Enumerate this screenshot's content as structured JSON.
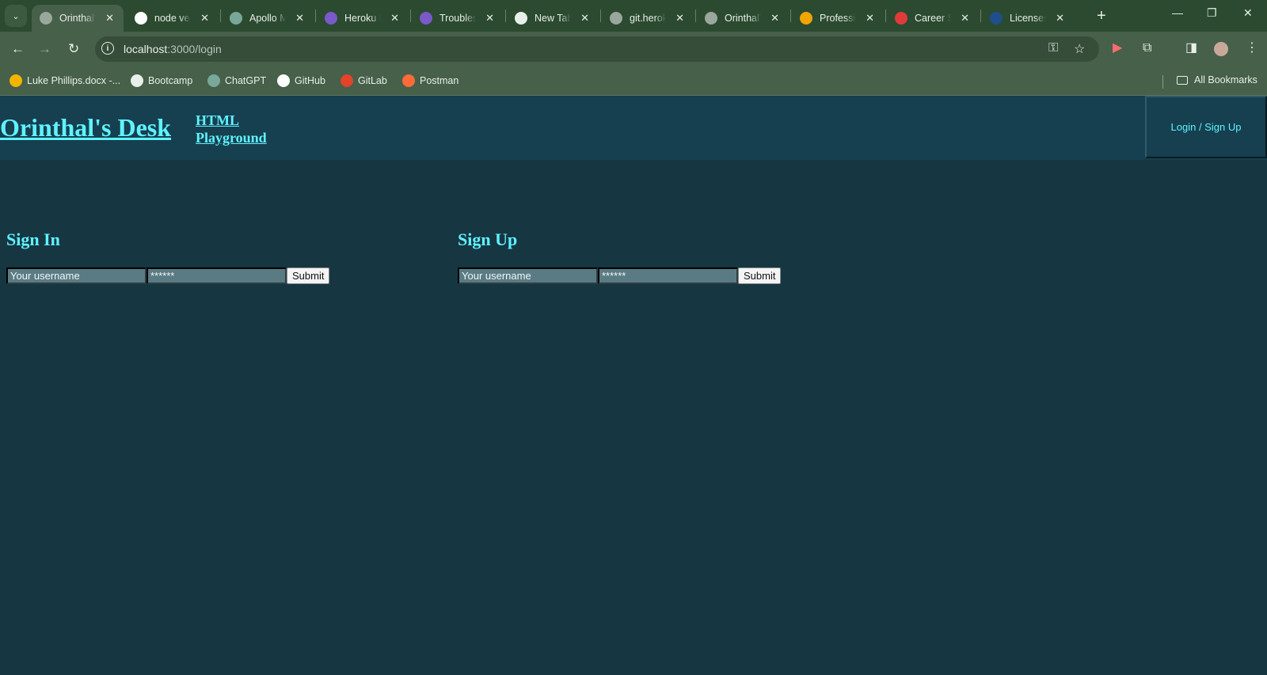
{
  "browser": {
    "tabs": [
      {
        "title": "Orinthal's Desk",
        "active": true,
        "favicon": "globe-icon",
        "color": "#9aa79c"
      },
      {
        "title": "node version",
        "active": false,
        "favicon": "google-icon",
        "color": "#ffffff"
      },
      {
        "title": "Apollo Mongo",
        "active": false,
        "favicon": "chatgpt-icon",
        "color": "#79a89a"
      },
      {
        "title": "Heroku Node",
        "active": false,
        "favicon": "heroku-icon",
        "color": "#7a59c9"
      },
      {
        "title": "Troubleshooting",
        "active": false,
        "favicon": "heroku-icon",
        "color": "#7a59c9"
      },
      {
        "title": "New Tab",
        "active": false,
        "favicon": "chrome-icon",
        "color": "#e8efe8"
      },
      {
        "title": "git.heroku",
        "active": false,
        "favicon": "globe-icon",
        "color": "#9aa79c"
      },
      {
        "title": "Orinthal's Desk",
        "active": false,
        "favicon": "globe-icon",
        "color": "#9aa79c"
      },
      {
        "title": "Professional",
        "active": false,
        "favicon": "fs-icon",
        "color": "#f0a500"
      },
      {
        "title": "Career Services",
        "active": false,
        "favicon": "career-icon",
        "color": "#e03b3b"
      },
      {
        "title": "Licenses",
        "active": false,
        "favicon": "question-icon",
        "color": "#1f4f8a"
      }
    ],
    "url_host": "localhost",
    "url_path": ":3000/login",
    "bookmarks": [
      {
        "label": "Luke Phillips.docx -...",
        "icon": "google-drive-icon",
        "color": "#f4b400"
      },
      {
        "label": "Bootcamp",
        "icon": "globe-icon",
        "color": "#e8efe8"
      },
      {
        "label": "ChatGPT",
        "icon": "chatgpt-icon",
        "color": "#79a89a"
      },
      {
        "label": "GitHub",
        "icon": "github-icon",
        "color": "#ffffff"
      },
      {
        "label": "GitLab",
        "icon": "gitlab-icon",
        "color": "#e24329"
      },
      {
        "label": "Postman",
        "icon": "postman-icon",
        "color": "#ff6c37"
      }
    ],
    "all_bookmarks": "All Bookmarks"
  },
  "site": {
    "title": "Orinthal's Desk",
    "nav_link": "HTML Playground",
    "login_button": "Login / Sign Up",
    "accent": "#5ff3ff"
  },
  "signin": {
    "heading": "Sign In",
    "username_placeholder": "Your username",
    "password_placeholder": "******",
    "submit": "Submit"
  },
  "signup": {
    "heading": "Sign Up",
    "username_placeholder": "Your username",
    "password_placeholder": "******",
    "submit": "Submit"
  }
}
